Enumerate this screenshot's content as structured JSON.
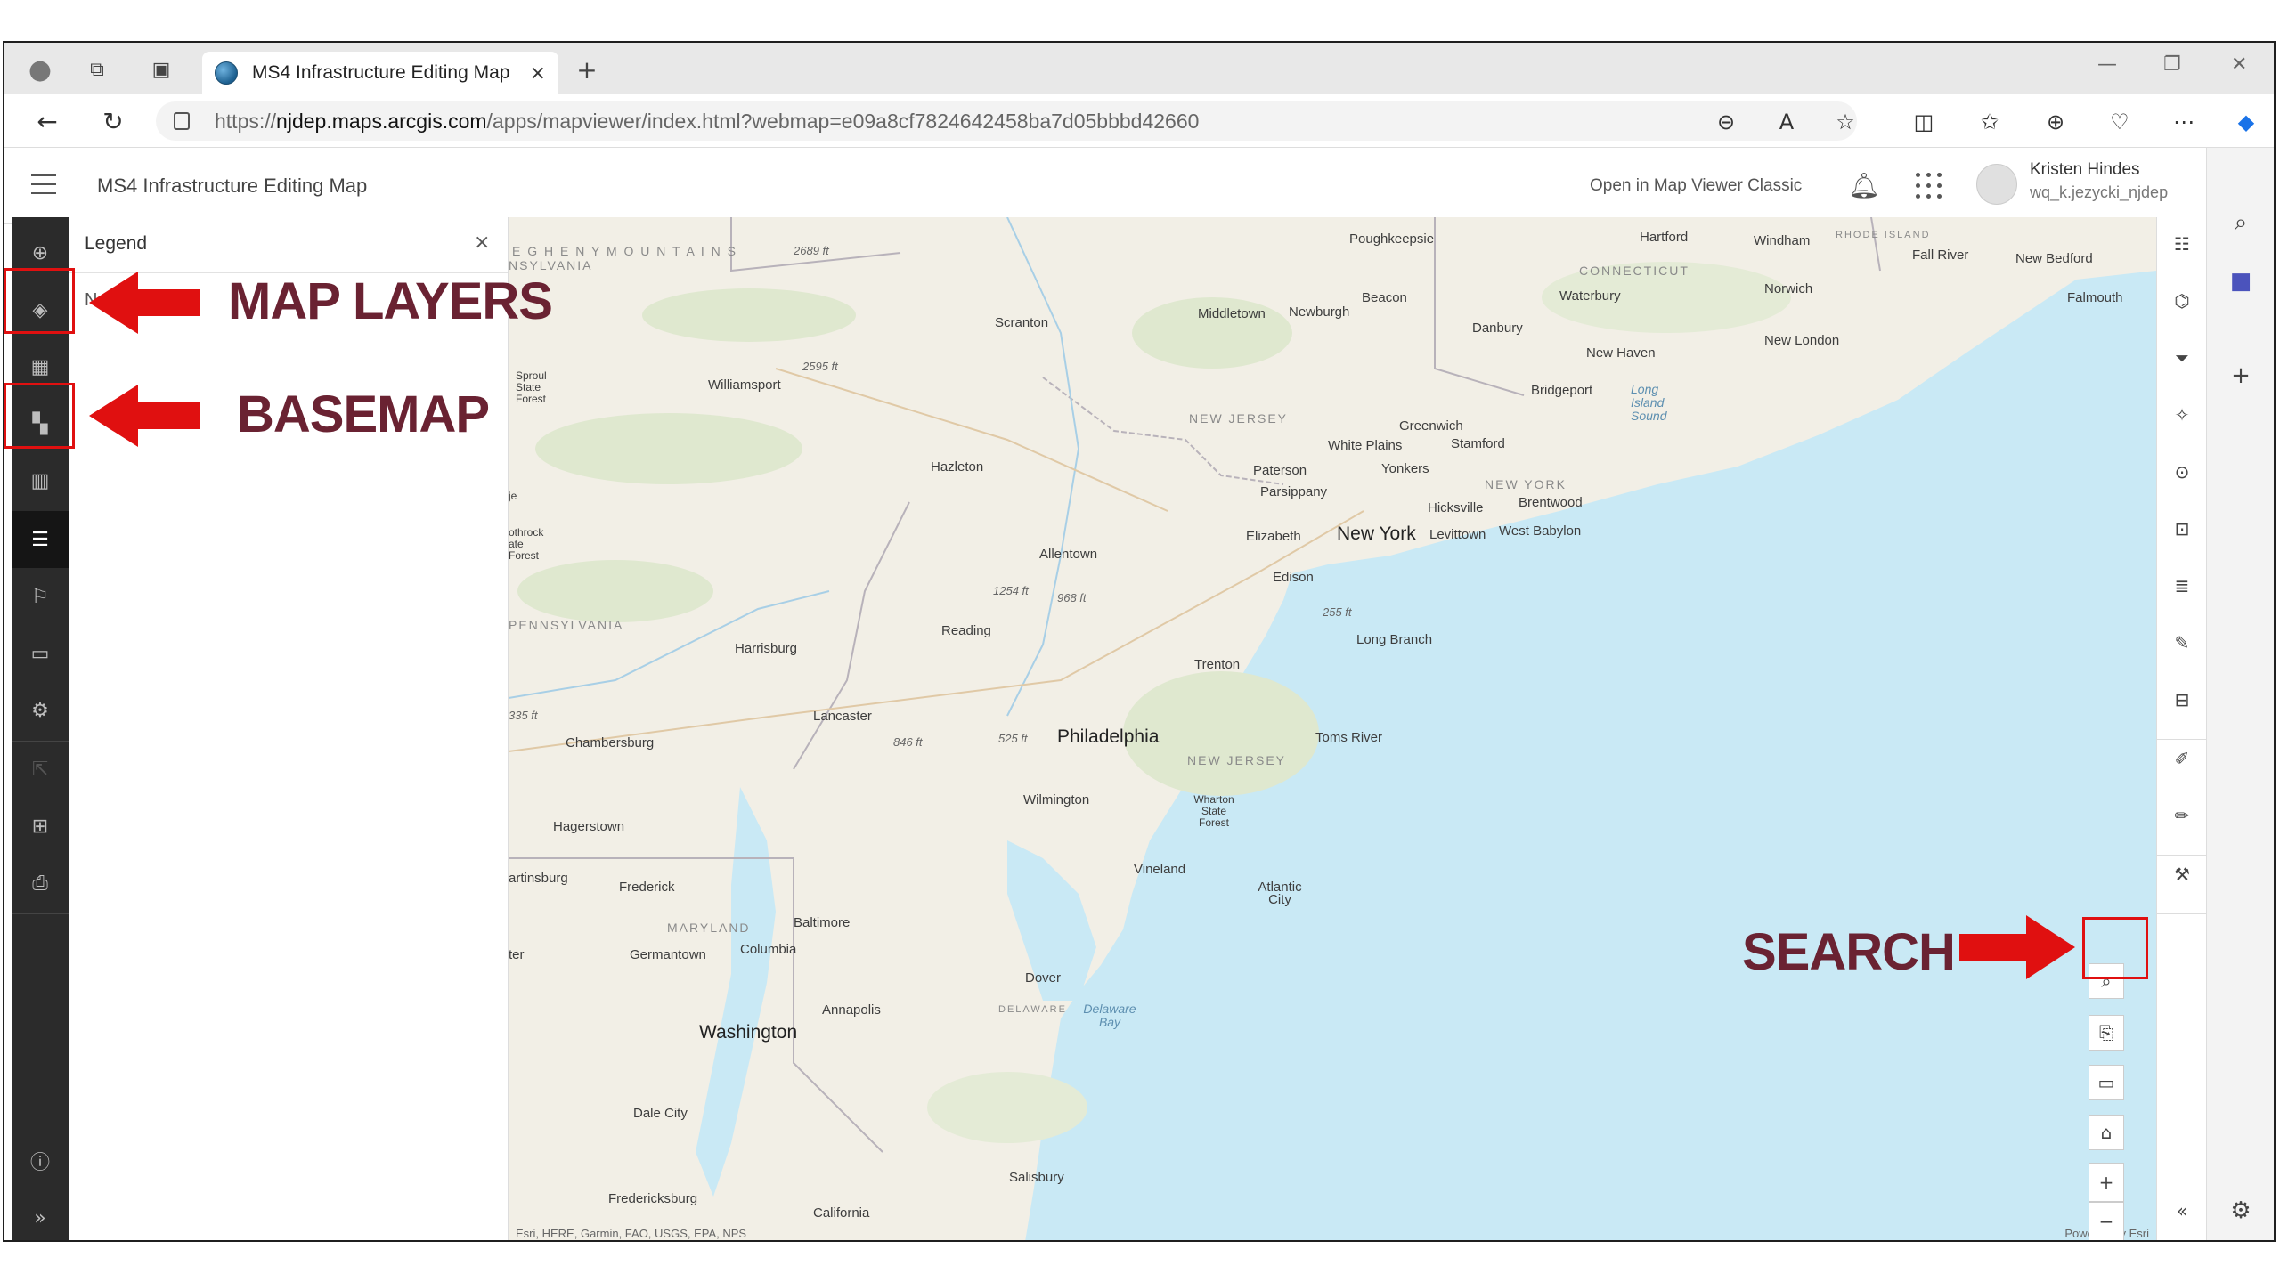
{
  "browser": {
    "tab_title": "MS4 Infrastructure Editing Map",
    "tab_close": "×",
    "new_tab": "+",
    "url_prefix": "https://",
    "url_domain": "njdep.maps.arcgis.com",
    "url_path": "/apps/mapviewer/index.html?webmap=e09a8cf7824642458ba7d05bbbd42660"
  },
  "app": {
    "title": "MS4 Infrastructure Editing Map",
    "open_classic": "Open in Map Viewer Classic",
    "user_name": "Kristen Hindes",
    "user_id": "wq_k.jezycki_njdep"
  },
  "legend": {
    "title": "Legend",
    "close": "×",
    "message": "N"
  },
  "map": {
    "attribution": "Esri, HERE, Garmin, FAO, USGS, EPA, NPS",
    "powered": "Powered by Esri",
    "labels": {
      "poughkeepsie": "Poughkeepsie",
      "hartford": "Hartford",
      "windham": "Windham",
      "rhode_island": "RHODE ISLAND",
      "fall_river": "Fall River",
      "new_bedford": "New Bedford",
      "connecticut": "CONNECTICUT",
      "waterbury": "Waterbury",
      "norwich": "Norwich",
      "falmouth": "Falmouth",
      "beacon": "Beacon",
      "middletown": "Middletown",
      "newburgh": "Newburgh",
      "danbury": "Danbury",
      "new_london": "New London",
      "new_haven": "New Haven",
      "scranton": "Scranton",
      "williamsport": "Williamsport",
      "sproul": "Sproul State Forest",
      "bridgeport": "Bridgeport",
      "long_island_sound": "Long Island Sound",
      "greenwich": "Greenwich",
      "stamford": "Stamford",
      "new_jersey": "NEW JERSEY",
      "white_plains": "White Plains",
      "yonkers": "Yonkers",
      "paterson": "Paterson",
      "new_york_state": "NEW YORK",
      "parsippany": "Parsippany",
      "hicksville": "Hicksville",
      "brentwood": "Brentwood",
      "hazleton": "Hazleton",
      "elizabeth": "Elizabeth",
      "new_york": "New York",
      "levittown": "Levittown",
      "west_babylon": "West Babylon",
      "allentown": "Allentown",
      "edison": "Edison",
      "pennsylvania": "PENNSYLVANIA",
      "reading": "Reading",
      "long_branch": "Long Branch",
      "harrisburg": "Harrisburg",
      "trenton": "Trenton",
      "lancaster": "Lancaster",
      "chambersburg": "Chambersburg",
      "philadelphia": "Philadelphia",
      "toms_river": "Toms River",
      "new_jersey2": "NEW JERSEY",
      "wilmington": "Wilmington",
      "wharton": "Wharton State Forest",
      "hagerstown": "Hagerstown",
      "vineland": "Vineland",
      "martinsburg": "artinsburg",
      "frederick": "Frederick",
      "atlantic_city": "Atlantic City",
      "maryland": "MARYLAND",
      "baltimore": "Baltimore",
      "germantown": "Germantown",
      "columbia": "Columbia",
      "dover": "Dover",
      "annapolis": "Annapolis",
      "delaware": "DELAWARE",
      "delaware_bay": "Delaware Bay",
      "washington": "Washington",
      "dale_city": "Dale City",
      "salisbury": "Salisbury",
      "fredericksburg": "Fredericksburg",
      "california": "California",
      "allegheny": "E G H E N Y   M O U N T A I N S",
      "nsylvania": "NSYLVANIA",
      "bothrock": "othrock ate Forest",
      "e2689": "2689 ft",
      "e2595": "2595 ft",
      "e1254": "1254 ft",
      "e968": "968 ft",
      "e255": "255 ft",
      "e335": "335 ft",
      "e846": "846 ft",
      "e525": "525 ft",
      "tler": "ter",
      "je": "je"
    }
  },
  "annotations": {
    "map_layers": "MAP LAYERS",
    "basemap": "BASEMAP",
    "search": "SEARCH",
    "color": "#e01010",
    "text_color": "#6a2232"
  },
  "colors": {
    "rail_bg": "#2b2b2b",
    "water": "#c9e9f5",
    "land": "#f2efe6"
  }
}
